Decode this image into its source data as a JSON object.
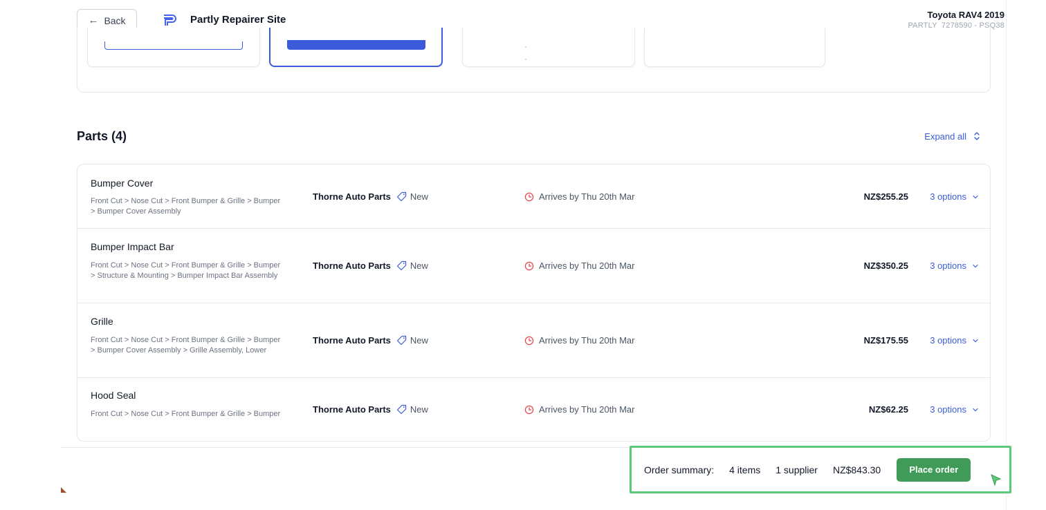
{
  "header": {
    "back_label": "Back",
    "site_title": "Partly Repairer Site",
    "vehicle_name": "Toyota RAV4 2019",
    "vehicle_code": "PARTLY_7278590 - PSQ38"
  },
  "parts": {
    "heading": "Parts (4)",
    "expand_all_label": "Expand all",
    "items": [
      {
        "name": "Bumper Cover",
        "path": "Front Cut > Nose Cut > Front Bumper & Grille > Bumper > Bumper Cover Assembly",
        "supplier": "Thorne Auto Parts",
        "condition": "New",
        "arrival": "Arrives by Thu 20th Mar",
        "price": "NZ$255.25",
        "options": "3 options"
      },
      {
        "name": "Bumper Impact Bar",
        "path": "Front Cut > Nose Cut > Front Bumper & Grille > Bumper > Structure & Mounting > Bumper Impact Bar Assembly",
        "supplier": "Thorne Auto Parts",
        "condition": "New",
        "arrival": "Arrives by Thu 20th Mar",
        "price": "NZ$350.25",
        "options": "3 options"
      },
      {
        "name": "Grille",
        "path": "Front Cut > Nose Cut > Front Bumper & Grille > Bumper > Bumper Cover Assembly > Grille Assembly, Lower",
        "supplier": "Thorne Auto Parts",
        "condition": "New",
        "arrival": "Arrives by Thu 20th Mar",
        "price": "NZ$175.55",
        "options": "3 options"
      },
      {
        "name": "Hood Seal",
        "path": "Front Cut > Nose Cut > Front Bumper & Grille > Bumper",
        "supplier": "Thorne Auto Parts",
        "condition": "New",
        "arrival": "Arrives by Thu 20th Mar",
        "price": "NZ$62.25",
        "options": "3 options"
      }
    ]
  },
  "order_summary": {
    "label": "Order summary:",
    "items": "4 items",
    "suppliers": "1 supplier",
    "total": "NZ$843.30",
    "place_order_label": "Place order"
  },
  "colors": {
    "accent_blue": "#3b5bdb",
    "place_order_green": "#3f9b57",
    "highlight_green": "#5cc87a",
    "arrival_icon_red": "#e5484d"
  }
}
